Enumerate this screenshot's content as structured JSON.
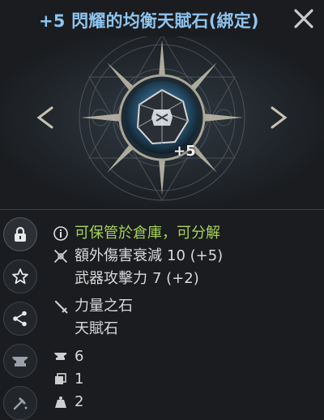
{
  "item": {
    "title": "+5 閃耀的均衡天賦石(綁定)",
    "enhance_badge": "+5"
  },
  "info": {
    "notice": "可保管於倉庫，可分解",
    "effects": [
      {
        "label": "額外傷害衰減",
        "value": "10 (+5)"
      },
      {
        "label": "武器攻擊力",
        "value": "7 (+2)"
      }
    ],
    "type_line1": "力量之石",
    "type_line2": "天賦石",
    "stat_a": "6",
    "stat_b": "1",
    "stat_c": "2"
  },
  "colors": {
    "title": "#8ec4ee",
    "notice": "#a6d35a"
  }
}
